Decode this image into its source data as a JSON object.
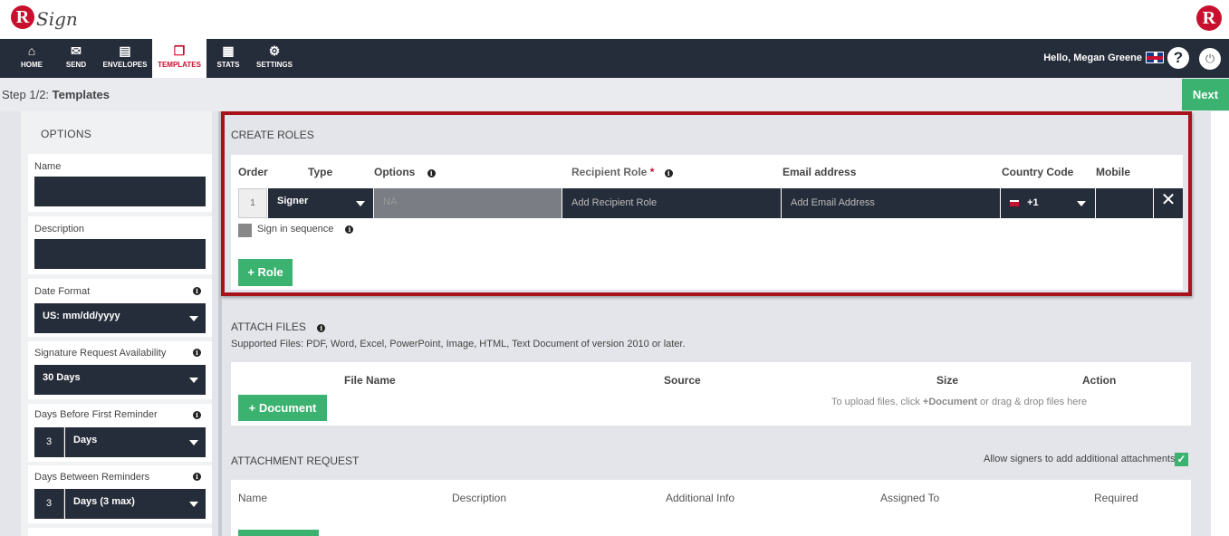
{
  "app": {
    "logo_letter": "R",
    "logo_text": "Sign",
    "corner_logo_letter": "R"
  },
  "nav": {
    "items": [
      {
        "label": "HOME",
        "icon": "home-icon",
        "glyph": "⌂"
      },
      {
        "label": "SEND",
        "icon": "envelope-icon",
        "glyph": "✉"
      },
      {
        "label": "ENVELOPES",
        "icon": "inbox-icon",
        "glyph": "▤"
      },
      {
        "label": "TEMPLATES",
        "icon": "templates-icon",
        "glyph": "❐"
      },
      {
        "label": "STATS",
        "icon": "briefcase-icon",
        "glyph": "▦"
      },
      {
        "label": "SETTINGS",
        "icon": "gear-icon",
        "glyph": "⚙"
      }
    ],
    "active": "TEMPLATES",
    "greeting": "Hello, Megan Greene",
    "help_glyph": "?",
    "power_glyph": "⏻"
  },
  "step": {
    "prefix": "Step 1/2:",
    "title": "Templates",
    "next_label": "Next"
  },
  "options": {
    "title": "OPTIONS",
    "name_label": "Name",
    "description_label": "Description",
    "date_format_label": "Date Format",
    "date_format_value": "US: mm/dd/yyyy",
    "availability_label": "Signature Request Availability",
    "availability_value": "30 Days",
    "first_reminder_label": "Days Before First Reminder",
    "first_reminder_num": "3",
    "first_reminder_unit": "Days",
    "between_reminders_label": "Days Between Reminders",
    "between_reminders_num": "3",
    "between_reminders_unit": "Days (3 max)",
    "info_glyph": "i"
  },
  "roles": {
    "title": "CREATE ROLES",
    "headers": {
      "order": "Order",
      "type": "Type",
      "options": "Options",
      "recipient_role": "Recipient Role",
      "required_mark": "*",
      "email": "Email address",
      "country_code": "Country Code",
      "mobile": "Mobile"
    },
    "row": {
      "order": "1",
      "type": "Signer",
      "options": "NA",
      "role_placeholder": "Add Recipient Role",
      "email_placeholder": "Add Email Address",
      "country_code": "+1",
      "close_glyph": "✕"
    },
    "sign_in_sequence": "Sign in sequence",
    "add_role": "+ Role"
  },
  "attach_files": {
    "title": "ATTACH FILES",
    "supported": "Supported Files: PDF, Word, Excel, PowerPoint, Image, HTML, Text Document of version 2010 or later.",
    "headers": {
      "file_name": "File Name",
      "source": "Source",
      "size": "Size",
      "action": "Action"
    },
    "add_document": "+ Document",
    "hint_prefix": "To upload files, click ",
    "hint_bold": "+Document",
    "hint_suffix": " or drag & drop files here"
  },
  "attachment_request": {
    "title": "ATTACHMENT REQUEST",
    "allow_label": "Allow signers to add additional attachments",
    "allow_checked": true,
    "check_glyph": "✓",
    "headers": {
      "name": "Name",
      "description": "Description",
      "additional_info": "Additional Info",
      "assigned_to": "Assigned To",
      "required": "Required"
    }
  },
  "colors": {
    "brand_red": "#c8102e",
    "nav_bg": "#262d3a",
    "accent_green": "#3bb26f",
    "highlight_border": "#a8131b"
  }
}
